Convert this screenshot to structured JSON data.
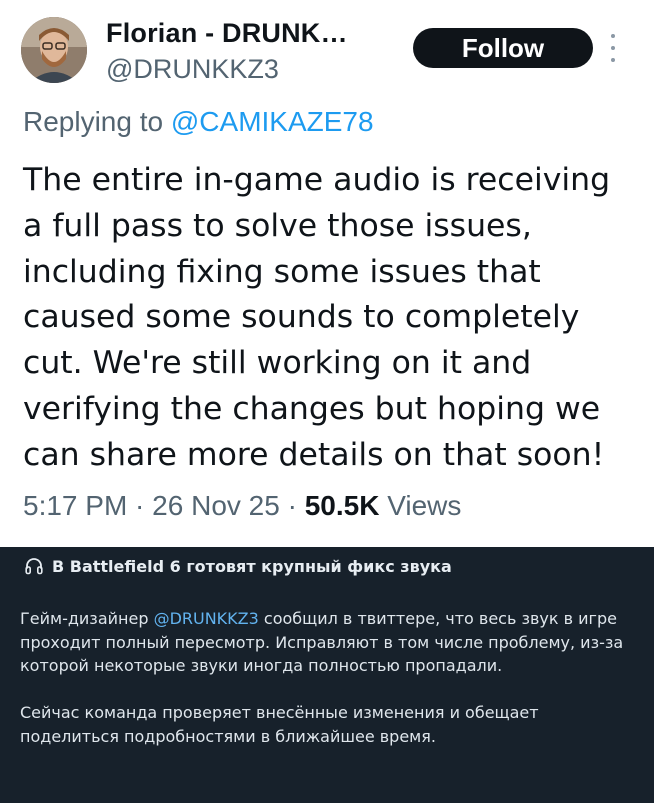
{
  "tweet": {
    "display_name": "Florian - DRUNK…",
    "handle": "@DRUNKKZ3",
    "follow_label": "Follow",
    "replying_prefix": "Replying to ",
    "replying_mention": "@CAMIKAZE78",
    "text": "The entire in-game audio is receiving a full pass to solve those issues, including fixing some issues that caused some sounds to completely cut. We're still working on it and verifying the changes but hoping we can share more details on that soon!",
    "time": "5:17 PM",
    "separator": " · ",
    "date": "26 Nov 25",
    "views_count": "50.5K",
    "views_label": " Views"
  },
  "post": {
    "header_icon": "headphones-icon",
    "header_title": "В Battlefield 6 готовят крупный фикс звука",
    "p1_before": "Гейм-дизайнер ",
    "p1_mention": "@DRUNKKZ3",
    "p1_after": " сообщил в твиттере, что весь звук в игре проходит полный пересмотр. Исправляют в том числе проблему, из-за которой некоторые звуки иногда полностью пропадали.",
    "p2": "Сейчас команда проверяет внесённые изменения и обещает поделиться подробностями в ближайшее время."
  },
  "colors": {
    "tweet_bg": "#ffffff",
    "page_bg": "#17212b",
    "follow_bg": "#0f1419",
    "link_blue": "#1d9bf0",
    "secondary_text": "#536471",
    "post_mention": "#62b3ef"
  }
}
